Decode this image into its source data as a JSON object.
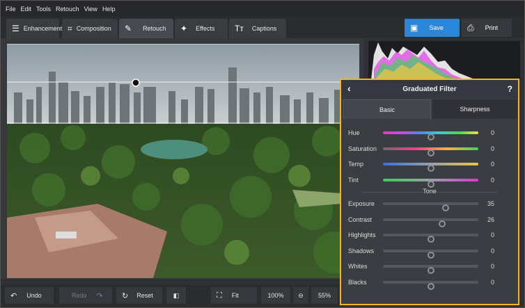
{
  "menu": [
    "File",
    "Edit",
    "Tools",
    "Retouch",
    "View",
    "Help"
  ],
  "tabs": [
    {
      "label": "Enhancement",
      "icon": "sliders-icon",
      "glyph": "☰"
    },
    {
      "label": "Composition",
      "icon": "crop-icon",
      "glyph": "⌗"
    },
    {
      "label": "Retouch",
      "icon": "brush-icon",
      "glyph": "✎"
    },
    {
      "label": "Effects",
      "icon": "magic-wand-icon",
      "glyph": "✦"
    },
    {
      "label": "Captions",
      "icon": "text-icon",
      "glyph": "Tт"
    }
  ],
  "actions": {
    "save": "Save",
    "print": "Print"
  },
  "panel": {
    "title": "Graduated Filter",
    "tab_basic": "Basic",
    "tab_sharpness": "Sharpness",
    "color_sliders": [
      {
        "label": "Hue",
        "value": "0",
        "pos": 0.5
      },
      {
        "label": "Saturation",
        "value": "0",
        "pos": 0.5
      },
      {
        "label": "Temp",
        "value": "0",
        "pos": 0.5
      },
      {
        "label": "Tint",
        "value": "0",
        "pos": 0.5
      }
    ],
    "tone_label": "Tone",
    "tone_sliders": [
      {
        "label": "Exposure",
        "value": "35",
        "pos": 0.66
      },
      {
        "label": "Contrast",
        "value": "26",
        "pos": 0.62
      },
      {
        "label": "Highlights",
        "value": "0",
        "pos": 0.5
      },
      {
        "label": "Shadows",
        "value": "0",
        "pos": 0.5
      },
      {
        "label": "Whites",
        "value": "0",
        "pos": 0.5
      },
      {
        "label": "Blacks",
        "value": "0",
        "pos": 0.5
      }
    ]
  },
  "bottom": {
    "undo": "Undo",
    "redo": "Redo",
    "reset": "Reset",
    "fit": "Fit",
    "zoom100": "100%",
    "zoom": "55%"
  },
  "colors": {
    "accent": "#f2b51d",
    "save": "#2a86d8"
  }
}
